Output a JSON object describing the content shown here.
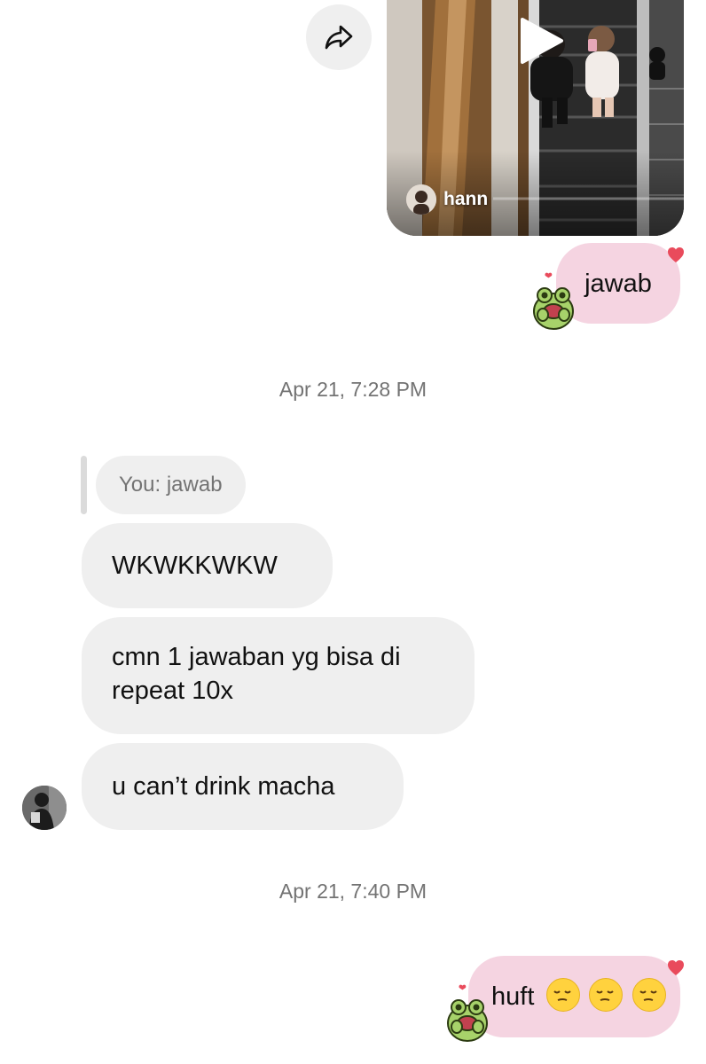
{
  "reel": {
    "username": "hann"
  },
  "messages": {
    "outgoing_1": "jawab",
    "timestamp_1": "Apr 21, 7:28 PM",
    "reply_preview": "You: jawab",
    "incoming_1": "WKWKKWKW",
    "incoming_2_line1": "cmn 1 jawaban yg bisa di",
    "incoming_2_line2": "repeat 10x",
    "incoming_3": "u can’t drink macha",
    "timestamp_2": "Apr 21, 7:40 PM",
    "outgoing_2": "huft"
  },
  "emoji": {
    "outgoing_2_emojis": [
      "pensive-face",
      "pensive-face",
      "pensive-face"
    ]
  },
  "colors": {
    "outgoing_bubble": "#f5d4e1",
    "incoming_bubble": "#efefef",
    "heart": "#e94b5c",
    "timestamp": "#737373"
  },
  "icons": {
    "share": "share-arrow-icon",
    "play": "play-icon",
    "heart": "heart-icon",
    "sticker": "frog-sticker-icon"
  }
}
